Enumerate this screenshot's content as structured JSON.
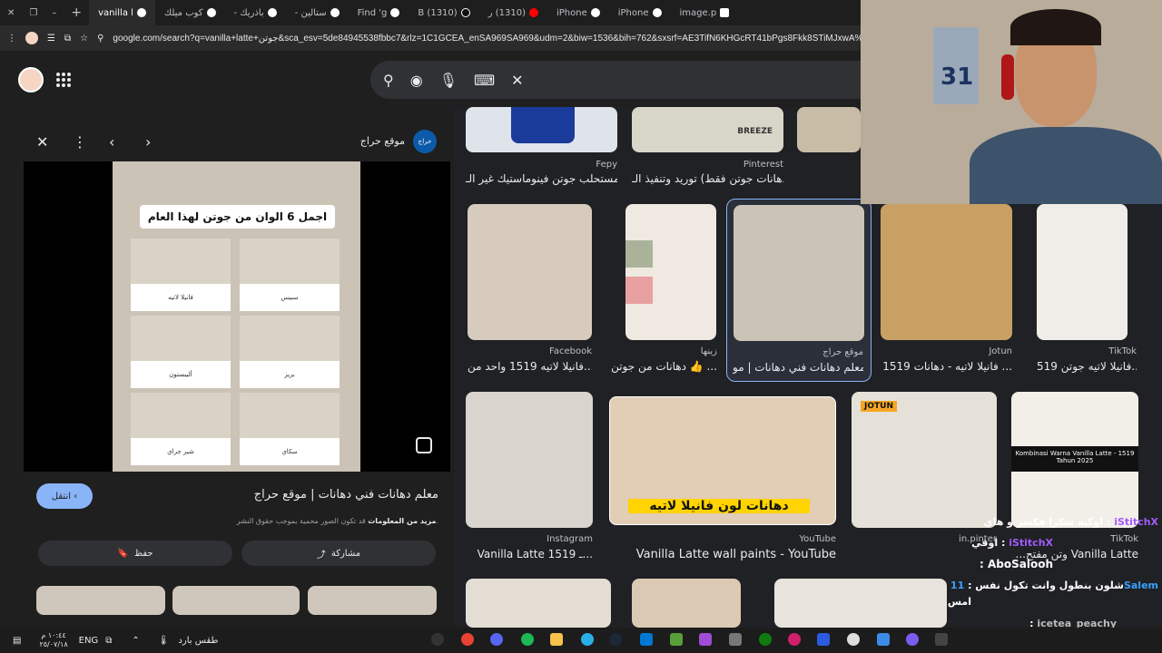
{
  "browser": {
    "tabs": [
      {
        "label": "vanilla l"
      },
      {
        "label": "كوب ميلك"
      },
      {
        "label": "باذريك -"
      },
      {
        "label": "ستالين -"
      },
      {
        "label": "Find 'g"
      },
      {
        "label": "(1310) B"
      },
      {
        "label": "(1310) ر"
      },
      {
        "label": "iPhone"
      },
      {
        "label": "iPhone"
      },
      {
        "label": "image.p"
      }
    ],
    "new_tab": "+",
    "url": "google.com/search?q=vanilla+latte+جوتن&sca_esv=5de84945538fbbc7&rlz=1C1GCEA_enSA969SA969&udm=2&biw=1536&bih=762&sxsrf=AE3TifN6KHGcRT41bPgs8Fkk8STiMJxwA%3A17"
  },
  "preview_panel": {
    "site_name": "موقع حراج",
    "site_logo_text": "حراج",
    "image_title": "اجمل 6 الوان من جوتن لهذا العام",
    "swatches": [
      "فانيلا لاتيه",
      "سبيس",
      "أليبستون",
      "بريز",
      "شير جراي",
      "سكاي"
    ],
    "back_label": "انتقل",
    "title": "معلم دهانات فني دهانات | موقع حراج",
    "copyright": "قد تكون الصور محمية بموجب حقوق النشر.",
    "more_info": "مزيد من المعلومات",
    "save_label": "حفظ",
    "share_label": "مشاركة"
  },
  "results": [
    {
      "source": "Fepy",
      "caption": "مستحلب جوتن فينوماستيك غير الـ..."
    },
    {
      "source": "Pinterest",
      "caption": "دهانات جوتن فقط) توريد وتنفيذ الـ...",
      "image_text": "BREEZE"
    },
    {
      "source": "Facebook",
      "caption": "فانيلا لاتيه 1519 واحد من..."
    },
    {
      "source": "زينها",
      "caption": "دهانات من جوتن 👍 ..."
    },
    {
      "source": "موقع حراج",
      "caption": "معلم دهانات فني دهانات | مو..."
    },
    {
      "source": "Jotun",
      "caption": "1519 فانيلا لاتيه - دهانات ..."
    },
    {
      "source": "TikTok",
      "caption": "فانيلا لاتيه جوتن 519..."
    },
    {
      "source": "Instagram",
      "caption": "Vanilla Latte 1519 ـ..."
    },
    {
      "source": "YouTube",
      "caption": "Vanilla Latte wall paints - YouTube",
      "image_text": "دهانات لون فانيلا لاتيه"
    },
    {
      "source": "in.pinter",
      "caption": "",
      "image_text": "JOTUN"
    },
    {
      "source": "TikTok",
      "caption": "...وتن مفتح Vanilla Latte",
      "image_text": "Kombinasi Warna Vanilla Latte - 1519 Tahun 2025"
    }
  ],
  "chat": [
    {
      "user": "iStitchX",
      "msg": "اوكيه شكرا فكسر و هاي :"
    },
    {
      "user": "iStitchX",
      "msg": "اوقي :"
    },
    {
      "user": "AboSalooh",
      "msg": ":"
    },
    {
      "user": "11Salem",
      "msg": "شلون بنطول وانت تكول نفس :"
    },
    {
      "user": "",
      "msg": "امس"
    },
    {
      "user": "icetea_peachy",
      "msg": ":"
    }
  ],
  "taskbar": {
    "time": "١٠:٤٤ م",
    "date": "٢٥/٠٧/١٨",
    "lang": "ENG",
    "weather": "طقس بارد"
  },
  "webcam_jersey": "31"
}
